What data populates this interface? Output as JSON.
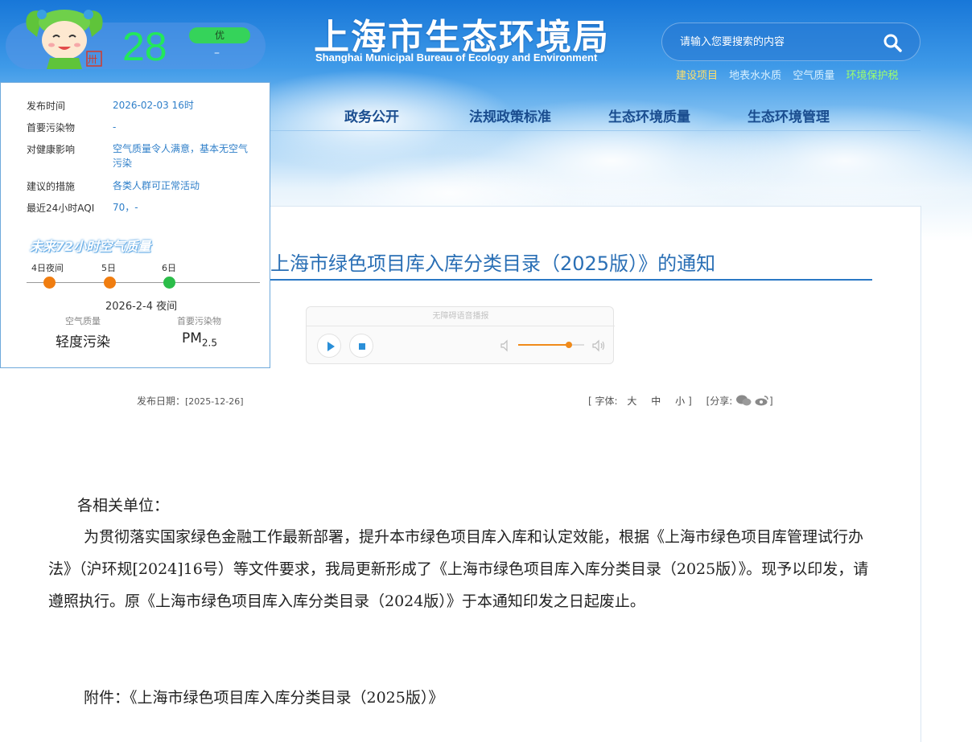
{
  "header": {
    "site_name_cn": "上海市生态环境局",
    "site_name_en": "Shanghai Municipal Bureau of Ecology and Environment",
    "search_placeholder": "请输入您要搜索的内容",
    "quick_links": [
      {
        "label": "建设项目",
        "color": "#ffe06a"
      },
      {
        "label": "地表水水质",
        "color": "#d8f0ff"
      },
      {
        "label": "空气质量",
        "color": "#d8f0ff"
      },
      {
        "label": "环境保护税",
        "color": "#9dff6b"
      }
    ],
    "nav": [
      "政务公开",
      "法规政策标准",
      "生态环境质量",
      "生态环境管理"
    ]
  },
  "weather": {
    "aqi": "28",
    "level": "优",
    "primary_pollutant_short": "–",
    "seal_char": "卅",
    "details": [
      {
        "label": "发布时间",
        "value": "2026-02-03 16时"
      },
      {
        "label": "首要污染物",
        "value": "-"
      },
      {
        "label": "对健康影响",
        "value": "空气质量令人满意，基本无空气污染"
      },
      {
        "label": "建议的措施",
        "value": "各类人群可正常活动"
      },
      {
        "label": "最近24小时AQI",
        "value": "70，-"
      }
    ],
    "forecast_title": "未来72小时空气质量",
    "timeline": [
      {
        "label": "4日夜间",
        "color": "#f07d10"
      },
      {
        "label": "5日",
        "color": "#f07d10"
      },
      {
        "label": "6日",
        "color": "#2bbd49"
      }
    ],
    "forecast_date": "2026-2-4 夜间",
    "aq_label": "空气质量",
    "aq_value": "轻度污染",
    "pollutant_label": "首要污染物",
    "pollutant_main": "PM",
    "pollutant_sub": "2.5"
  },
  "article": {
    "title": "上海市绿色项目库入库分类目录（2025版）》的通知",
    "player_caption": "无障碍语音播报",
    "publish_label": "发布日期：",
    "publish_date": "[2025-12-26]",
    "font_label": "[ 字体:",
    "font_sizes": [
      "大",
      "中",
      "小"
    ],
    "font_close": "]",
    "share_label": "[分享:",
    "share_close": "]",
    "salutation": "各相关单位：",
    "paragraph": "为贯彻落实国家绿色金融工作最新部署，提升本市绿色项目库入库和认定效能，根据《上海市绿色项目库管理试行办法》（沪环规[2024]16号）等文件要求，我局更新形成了《上海市绿色项目库入库分类目录（2025版）》。现予以印发，请遵照执行。原《上海市绿色项目库入库分类目录（2024版）》于本通知印发之日起废止。",
    "attachment": "附件：《上海市绿色项目库入库分类目录（2025版）》"
  },
  "icons": [
    "search-icon",
    "play-icon",
    "stop-icon",
    "volume-low-icon",
    "volume-high-icon",
    "wechat-icon",
    "weibo-icon",
    "mascot-icon"
  ]
}
